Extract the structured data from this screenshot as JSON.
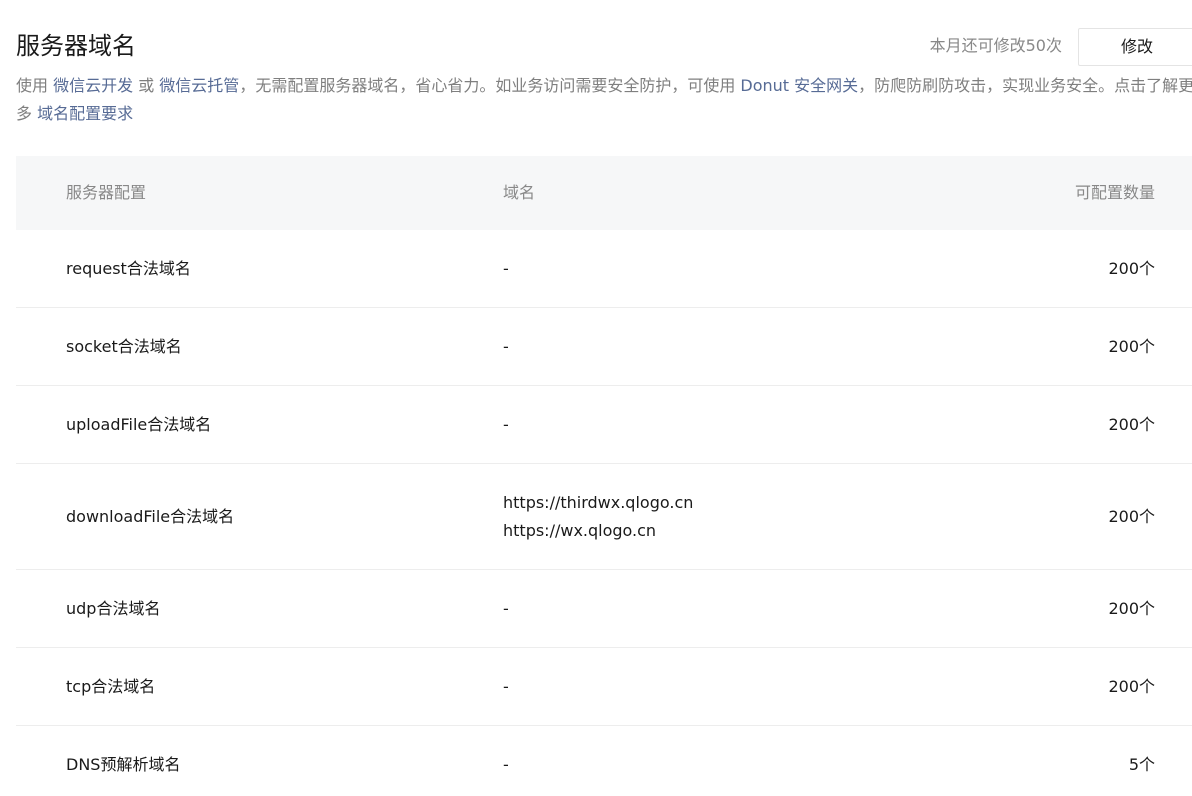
{
  "header": {
    "title": "服务器域名",
    "quota_text": "本月还可修改50次",
    "modify_label": "修改"
  },
  "description": {
    "part1": "使用 ",
    "link1": "微信云开发",
    "part2": " 或 ",
    "link2": "微信云托管",
    "part3": "，无需配置服务器域名，省心省力。如业务访问需要安全防护，可使用 ",
    "link3": "Donut 安全网关",
    "part4": "，防爬防刷防攻击，实现业务安全。点击了解更多 ",
    "link4": "域名配置要求"
  },
  "table": {
    "headers": {
      "config": "服务器配置",
      "domain": "域名",
      "count": "可配置数量"
    },
    "rows": [
      {
        "name": "request合法域名",
        "domains": [
          "-"
        ],
        "count": "200个"
      },
      {
        "name": "socket合法域名",
        "domains": [
          "-"
        ],
        "count": "200个"
      },
      {
        "name": "uploadFile合法域名",
        "domains": [
          "-"
        ],
        "count": "200个"
      },
      {
        "name": "downloadFile合法域名",
        "domains": [
          "https://thirdwx.qlogo.cn",
          "https://wx.qlogo.cn"
        ],
        "count": "200个"
      },
      {
        "name": "udp合法域名",
        "domains": [
          "-"
        ],
        "count": "200个"
      },
      {
        "name": "tcp合法域名",
        "domains": [
          "-"
        ],
        "count": "200个"
      },
      {
        "name": "DNS预解析域名",
        "domains": [
          "-"
        ],
        "count": "5个"
      }
    ]
  },
  "colors": {
    "link": "#576b95",
    "muted": "#888888",
    "header_bg": "#f6f7f8",
    "divider": "#ededed"
  }
}
